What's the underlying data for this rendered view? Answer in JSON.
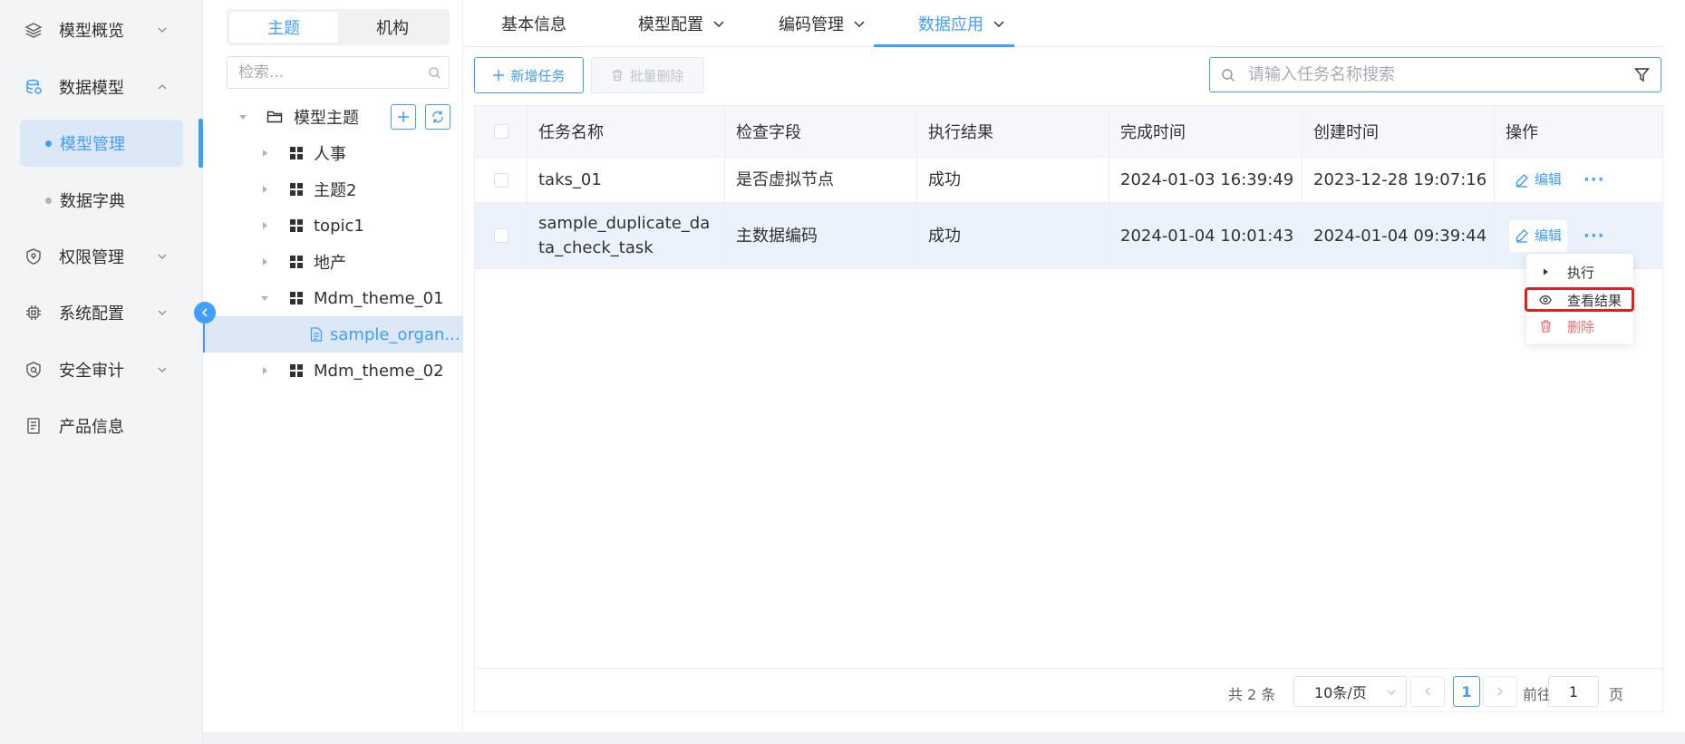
{
  "nav": {
    "items": [
      {
        "label": "模型概览",
        "icon": "layers-icon"
      },
      {
        "label": "数据模型",
        "icon": "database-icon"
      },
      {
        "label": "权限管理",
        "icon": "shield-icon"
      },
      {
        "label": "系统配置",
        "icon": "chip-icon"
      },
      {
        "label": "安全审计",
        "icon": "audit-icon"
      },
      {
        "label": "产品信息",
        "icon": "document-icon"
      }
    ],
    "sub_items": [
      {
        "label": "模型管理"
      },
      {
        "label": "数据字典"
      }
    ]
  },
  "tree": {
    "segments": [
      "主题",
      "机构"
    ],
    "search_placeholder": "检索...",
    "root_label": "模型主题",
    "nodes": [
      {
        "label": "人事"
      },
      {
        "label": "主题2"
      },
      {
        "label": "topic1"
      },
      {
        "label": "地产"
      },
      {
        "label": "Mdm_theme_01"
      },
      {
        "label": "sample_organ..."
      },
      {
        "label": "Mdm_theme_02"
      }
    ]
  },
  "tabs": [
    {
      "label": "基本信息"
    },
    {
      "label": "模型配置"
    },
    {
      "label": "编码管理"
    },
    {
      "label": "数据应用"
    }
  ],
  "toolbar": {
    "add_label": "新增任务",
    "batch_delete_label": "批量删除",
    "search_placeholder": "请输入任务名称搜索"
  },
  "table": {
    "columns": [
      "任务名称",
      "检查字段",
      "执行结果",
      "完成时间",
      "创建时间",
      "操作"
    ],
    "rows": [
      {
        "name": "taks_01",
        "field": "是否虚拟节点",
        "result": "成功",
        "finished": "2024-01-03 16:39:49",
        "created": "2023-12-28 19:07:16"
      },
      {
        "name": "sample_duplicate_data_check_task",
        "field": "主数据编码",
        "result": "成功",
        "finished": "2024-01-04 10:01:43",
        "created": "2024-01-04 09:39:44"
      }
    ],
    "edit_label": "编辑",
    "more_label": "···"
  },
  "dropdown": {
    "items": [
      {
        "label": "执行"
      },
      {
        "label": "查看结果"
      },
      {
        "label": "删除"
      }
    ]
  },
  "pagination": {
    "total": "共 2 条",
    "page_size": "10条/页",
    "current_page": "1",
    "goto_prefix": "前往",
    "goto_value": "1",
    "goto_suffix": "页"
  },
  "colors": {
    "primary": "#409eff",
    "danger": "#f56c6c",
    "highlight": "#e0201f"
  }
}
